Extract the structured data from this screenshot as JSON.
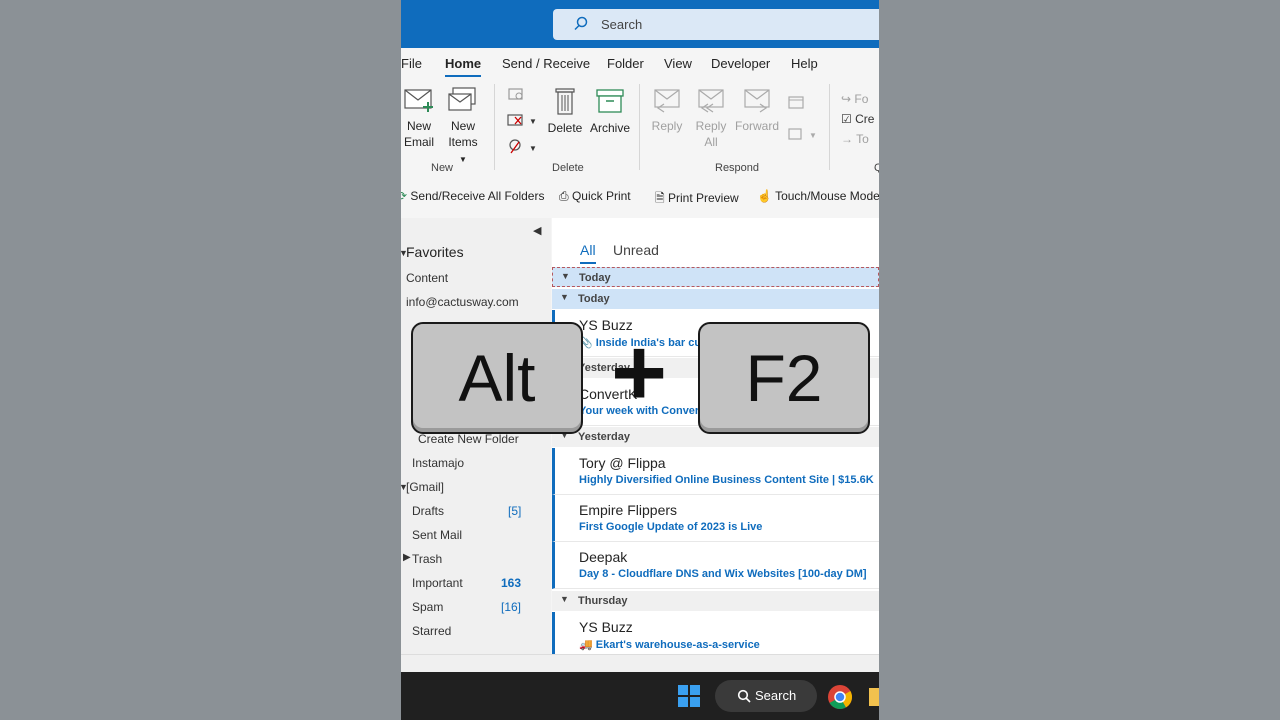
{
  "search": {
    "placeholder": "Search"
  },
  "tabs": [
    "File",
    "Home",
    "Send / Receive",
    "Folder",
    "View",
    "Developer",
    "Help"
  ],
  "ribbon": {
    "new_email": [
      "New",
      "Email"
    ],
    "new_items": [
      "New",
      "Items"
    ],
    "group_new": "New",
    "delete": "Delete",
    "archive": "Archive",
    "group_delete": "Delete",
    "reply": "Reply",
    "reply_all": [
      "Reply",
      "All"
    ],
    "forward": "Forward",
    "group_respond": "Respond",
    "qs_items": [
      "Fo",
      "Cre",
      "To"
    ],
    "qs_group": "Q"
  },
  "quick_toolbar": [
    "Send/Receive All Folders",
    "Quick Print",
    "Print Preview",
    "Touch/Mouse Mode"
  ],
  "folders": {
    "favorites": "Favorites",
    "items": [
      {
        "label": "Content"
      },
      {
        "label": "info@cactusway.com"
      },
      {
        "label": "Create New Folder"
      },
      {
        "label": "Instamajo"
      },
      {
        "label": "[Gmail]"
      },
      {
        "label": "Drafts",
        "count": "[5]"
      },
      {
        "label": "Sent Mail"
      },
      {
        "label": "Trash"
      },
      {
        "label": "Important",
        "count": "163"
      },
      {
        "label": "Spam",
        "count": "[16]"
      },
      {
        "label": "Starred"
      }
    ]
  },
  "list": {
    "filters": [
      "All",
      "Unread"
    ],
    "groups": [
      "Today",
      "Today",
      "Yesterday",
      "Yesterday",
      "Thursday"
    ],
    "messages": [
      {
        "from": "YS Buzz",
        "subject": "Inside India's bar cu"
      },
      {
        "from": "ConvertK",
        "subject": "Your week with Convert"
      },
      {
        "from": "Tory @ Flippa",
        "subject": "Highly Diversified Online Business Content Site | $15.6K"
      },
      {
        "from": "Empire Flippers",
        "subject": "First Google Update of 2023 is Live"
      },
      {
        "from": "Deepak",
        "subject": "Day 8 - Cloudflare DNS and Wix Websites [100-day DM]"
      },
      {
        "from": "YS Buzz",
        "subject": "Ekart's warehouse-as-a-service"
      }
    ]
  },
  "taskbar": {
    "search": "Search"
  },
  "overlay": {
    "key1": "Alt",
    "plus": "+",
    "key2": "F2"
  },
  "colors": {
    "accent": "#0f6cbd",
    "titlebar": "#0f6cbd",
    "keycap": "#c3c3c3"
  }
}
